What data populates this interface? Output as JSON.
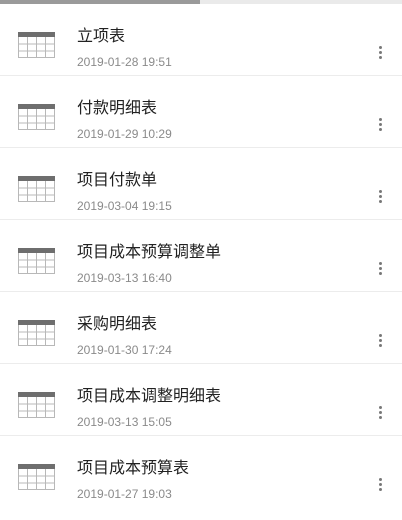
{
  "colors": {
    "title": "#222222",
    "date": "#8a8a8a",
    "icon_header": "#6e6e6e",
    "icon_grid": "#b8b8b8",
    "divider": "#ececec"
  },
  "list": {
    "items": [
      {
        "title": "立项表",
        "date": "2019-01-28 19:51",
        "icon": "table-icon"
      },
      {
        "title": "付款明细表",
        "date": "2019-01-29 10:29",
        "icon": "table-icon"
      },
      {
        "title": "项目付款单",
        "date": "2019-03-04 19:15",
        "icon": "table-icon"
      },
      {
        "title": "项目成本预算调整单",
        "date": "2019-03-13 16:40",
        "icon": "table-icon"
      },
      {
        "title": "采购明细表",
        "date": "2019-01-30 17:24",
        "icon": "table-icon"
      },
      {
        "title": "项目成本调整明细表",
        "date": "2019-03-13 15:05",
        "icon": "table-icon"
      },
      {
        "title": "项目成本预算表",
        "date": "2019-01-27 19:03",
        "icon": "table-icon"
      }
    ]
  }
}
